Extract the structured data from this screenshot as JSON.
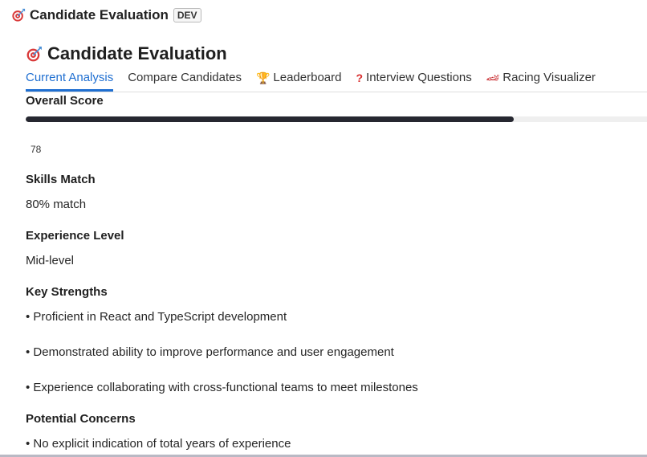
{
  "app": {
    "window_title": "Candidate Evaluation",
    "env_badge": "DEV",
    "icon": "target-icon"
  },
  "header": {
    "title": "Candidate Evaluation",
    "icon": "target-icon"
  },
  "tabs": [
    {
      "label": "Current Analysis",
      "icon": "",
      "active": true
    },
    {
      "label": "Compare Candidates",
      "icon": "",
      "active": false
    },
    {
      "label": "Leaderboard",
      "icon": "trophy-icon",
      "active": false
    },
    {
      "label": "Interview Questions",
      "icon": "question-icon",
      "active": false
    },
    {
      "label": "Racing Visualizer",
      "icon": "race-car-icon",
      "active": false
    }
  ],
  "overall_score": {
    "label": "Overall Score",
    "value": "78",
    "progress_fraction": 0.78
  },
  "skills_match": {
    "label": "Skills Match",
    "value": "80% match"
  },
  "experience_level": {
    "label": "Experience Level",
    "value": "Mid-level"
  },
  "key_strengths": {
    "label": "Key Strengths",
    "items": [
      "• Proficient in React and TypeScript development",
      "• Demonstrated ability to improve performance and user engagement",
      "• Experience collaborating with cross-functional teams to meet milestones"
    ]
  },
  "potential_concerns": {
    "label": "Potential Concerns",
    "items": [
      "• No explicit indication of total years of experience"
    ]
  },
  "colors": {
    "accent": "#1f6fd1",
    "progress_fill": "#262730",
    "progress_track": "#efefef"
  }
}
